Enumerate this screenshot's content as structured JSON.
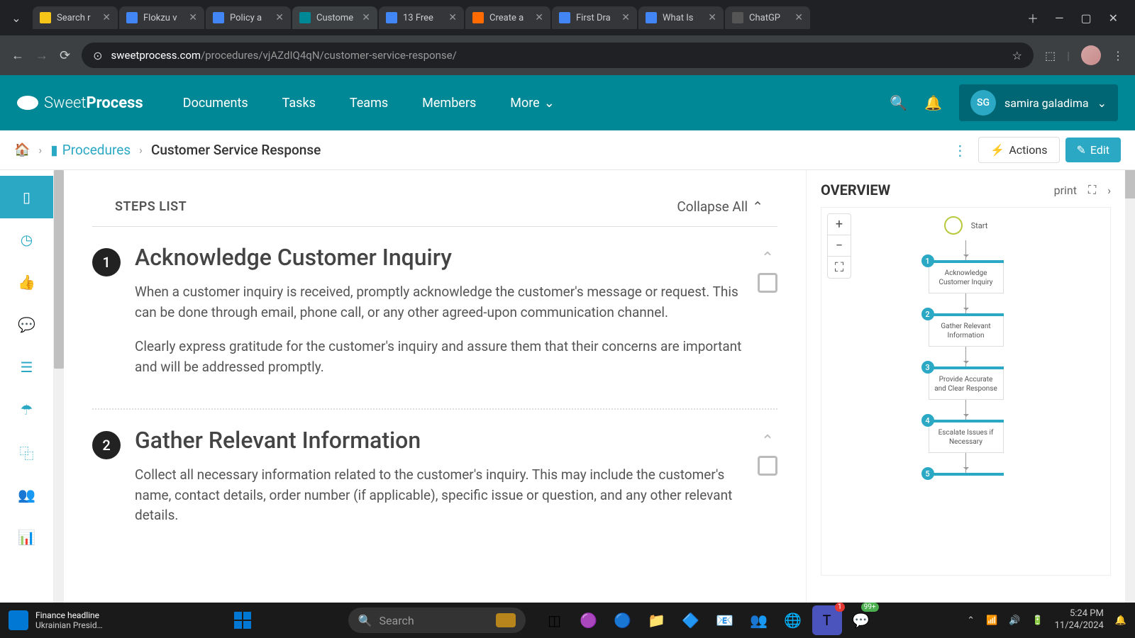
{
  "browser": {
    "tabs": [
      {
        "icon": "#f5c518",
        "title": "Search r"
      },
      {
        "icon": "#4285f4",
        "title": "Flokzu v"
      },
      {
        "icon": "#4285f4",
        "title": "Policy a"
      },
      {
        "icon": "#008896",
        "title": "Custome",
        "active": true
      },
      {
        "icon": "#4285f4",
        "title": "13 Free"
      },
      {
        "icon": "#ff6b00",
        "title": "Create a"
      },
      {
        "icon": "#4285f4",
        "title": "First Dra"
      },
      {
        "icon": "#4285f4",
        "title": "What Is"
      },
      {
        "icon": "#555",
        "title": "ChatGP"
      }
    ],
    "url_domain": "sweetprocess.com",
    "url_path": "/procedures/vjAZdIQ4qN/customer-service-response/"
  },
  "app": {
    "logo": {
      "light": "Sweet",
      "bold": "Process"
    },
    "nav": [
      "Documents",
      "Tasks",
      "Teams",
      "Members",
      "More"
    ],
    "user": {
      "initials": "SG",
      "name": "samira galadima"
    }
  },
  "breadcrumb": {
    "link": "Procedures",
    "current": "Customer Service Response",
    "actions": "Actions",
    "edit": "Edit"
  },
  "steps": {
    "header": "STEPS LIST",
    "collapse": "Collapse All",
    "items": [
      {
        "num": "1",
        "title": "Acknowledge Customer Inquiry",
        "p1": "When a customer inquiry is received, promptly acknowledge the customer's message or request. This can be done through email, phone call, or any other agreed-upon communication channel.",
        "p2": "Clearly express gratitude for the customer's inquiry and assure them that their concerns are important and will be addressed promptly."
      },
      {
        "num": "2",
        "title": "Gather Relevant Information",
        "p1": "Collect all necessary information related to the customer's inquiry. This may include the customer's name, contact details, order number (if applicable), specific issue or question, and any other relevant details.",
        "p2": ""
      }
    ]
  },
  "overview": {
    "title": "OVERVIEW",
    "print": "print",
    "start": "Start",
    "nodes": [
      {
        "n": "1",
        "label": "Acknowledge Customer Inquiry"
      },
      {
        "n": "2",
        "label": "Gather Relevant Information"
      },
      {
        "n": "3",
        "label": "Provide Accurate and Clear Response"
      },
      {
        "n": "4",
        "label": "Escalate Issues if Necessary"
      },
      {
        "n": "5",
        "label": ""
      }
    ]
  },
  "taskbar": {
    "news_title": "Finance headline",
    "news_sub": "Ukrainian Presid…",
    "search": "Search",
    "badge1": "1",
    "badge2": "99+",
    "time": "5:24 PM",
    "date": "11/24/2024"
  }
}
